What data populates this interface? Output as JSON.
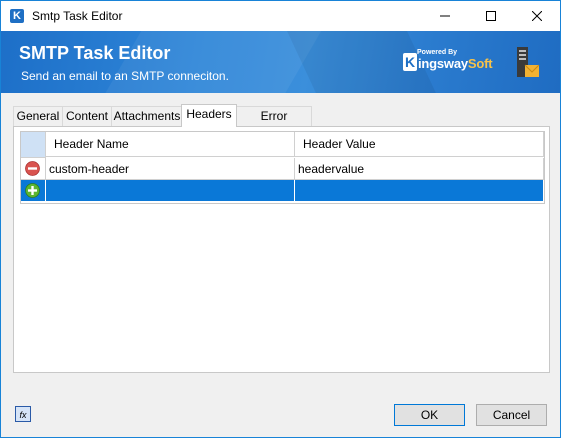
{
  "window": {
    "title": "Smtp Task Editor"
  },
  "banner": {
    "title": "SMTP Task Editor",
    "subtitle": "Send an email to an SMTP conneciton.",
    "logo_powered": "Powered By",
    "logo_k": "K",
    "logo_name": "ingsway",
    "logo_soft": "Soft"
  },
  "tabs": [
    {
      "label": "General"
    },
    {
      "label": "Content"
    },
    {
      "label": "Attachments"
    },
    {
      "label": "Headers"
    },
    {
      "label": "Error Handling"
    }
  ],
  "active_tab": "Headers",
  "grid": {
    "columns": [
      "Header Name",
      "Header Value"
    ],
    "rows": [
      {
        "name": "custom-header",
        "value": "headervalue",
        "action": "remove"
      },
      {
        "name": "",
        "value": "",
        "action": "add",
        "selected": true
      }
    ]
  },
  "footer": {
    "fx_label": "fx",
    "ok_label": "OK",
    "cancel_label": "Cancel"
  },
  "colors": {
    "banner": "#2f86d8",
    "selection": "#0a78d7",
    "remove_icon": "#d9534f",
    "add_icon": "#5cb531"
  }
}
